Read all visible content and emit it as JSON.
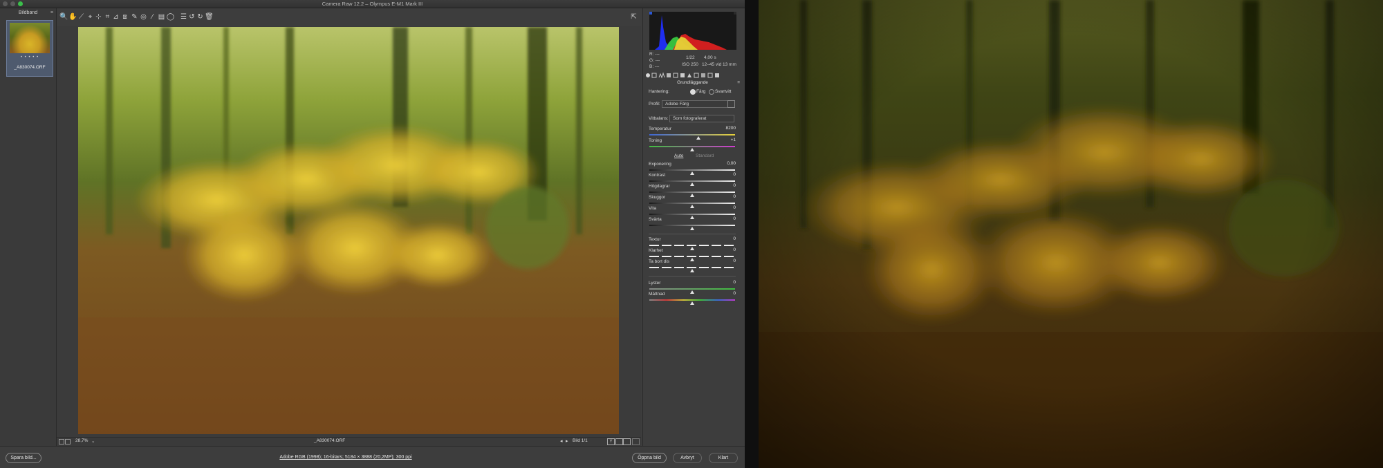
{
  "window": {
    "title": "Camera Raw 12.2  –  Olympus E-M1 Mark III"
  },
  "filmstrip": {
    "header": "Bildband",
    "menu_icon": "≡",
    "stars": "• • • • •",
    "filename": "_A830074.ORF"
  },
  "toolbar": {
    "tools": [
      {
        "name": "zoom-tool-icon",
        "glyph": "🔍"
      },
      {
        "name": "hand-tool-icon",
        "glyph": "✋"
      },
      {
        "name": "white-balance-icon",
        "glyph": "⟋"
      },
      {
        "name": "color-sampler-icon",
        "glyph": "⌖"
      },
      {
        "name": "targeted-adjust-icon",
        "glyph": "⊹"
      },
      {
        "name": "crop-icon",
        "glyph": "⌗"
      },
      {
        "name": "straighten-icon",
        "glyph": "⊿"
      },
      {
        "name": "transform-icon",
        "glyph": "⧈"
      },
      {
        "name": "spot-removal-icon",
        "glyph": "✎"
      },
      {
        "name": "red-eye-icon",
        "glyph": "◎"
      },
      {
        "name": "brush-icon",
        "glyph": "⁄"
      },
      {
        "name": "graduated-filter-icon",
        "glyph": "▤"
      },
      {
        "name": "radial-filter-icon",
        "glyph": "◯"
      },
      {
        "name": "preferences-icon",
        "glyph": "☰"
      },
      {
        "name": "rotate-left-icon",
        "glyph": "↺"
      },
      {
        "name": "rotate-right-icon",
        "glyph": "↻"
      },
      {
        "name": "delete-icon",
        "glyph": "🗑"
      }
    ],
    "fullscreen_icon": "⇱"
  },
  "status": {
    "zoom": "28,7%",
    "filename": "_A830074.ORF",
    "image_count": "Bild 1/1"
  },
  "bottom": {
    "save_label": "Spara bild...",
    "workflow_link": "Adobe RGB (1998); 16-bitars; 5184 × 3888 (20,2MP); 300 ppi",
    "open_label": "Öppna bild",
    "cancel_label": "Avbryt",
    "done_label": "Klart"
  },
  "histogram": {
    "r_label": "R:",
    "g_label": "G:",
    "b_label": "B:",
    "dashes": "---",
    "shutter": "1/22",
    "aperture": "4,00 s",
    "iso": "ISO 250",
    "lens": "12–45 vid 13 mm"
  },
  "panel": {
    "section_title": "Grundläggande",
    "treatment_label": "Hantering:",
    "treatment_color": "Färg",
    "treatment_bw": "Svartvitt",
    "profile_label": "Profil:",
    "profile_value": "Adobe Färg",
    "wb_label": "Vitbalans:",
    "wb_value": "Som fotograferat",
    "auto_label": "Auto",
    "default_label": "Standard",
    "sliders": [
      {
        "label": "Temperatur",
        "value": "8200",
        "pos": 0.57
      },
      {
        "label": "Toning",
        "value": "+1",
        "pos": 0.5
      },
      {
        "label": "Exponering",
        "value": "0,00",
        "pos": 0.5
      },
      {
        "label": "Kontrast",
        "value": "0",
        "pos": 0.5
      },
      {
        "label": "Högdagrar",
        "value": "0",
        "pos": 0.5
      },
      {
        "label": "Skuggor",
        "value": "0",
        "pos": 0.5
      },
      {
        "label": "Vita",
        "value": "0",
        "pos": 0.5
      },
      {
        "label": "Svärta",
        "value": "0",
        "pos": 0.5
      },
      {
        "label": "Textur",
        "value": "0",
        "pos": 0.5
      },
      {
        "label": "Klarhet",
        "value": "0",
        "pos": 0.5
      },
      {
        "label": "Ta bort dis",
        "value": "0",
        "pos": 0.5
      },
      {
        "label": "Lyster",
        "value": "0",
        "pos": 0.5
      },
      {
        "label": "Mättnad",
        "value": "0",
        "pos": 0.5
      }
    ]
  },
  "colors": {
    "accent": "#3b6bd6",
    "panel": "#3d3d3d"
  }
}
